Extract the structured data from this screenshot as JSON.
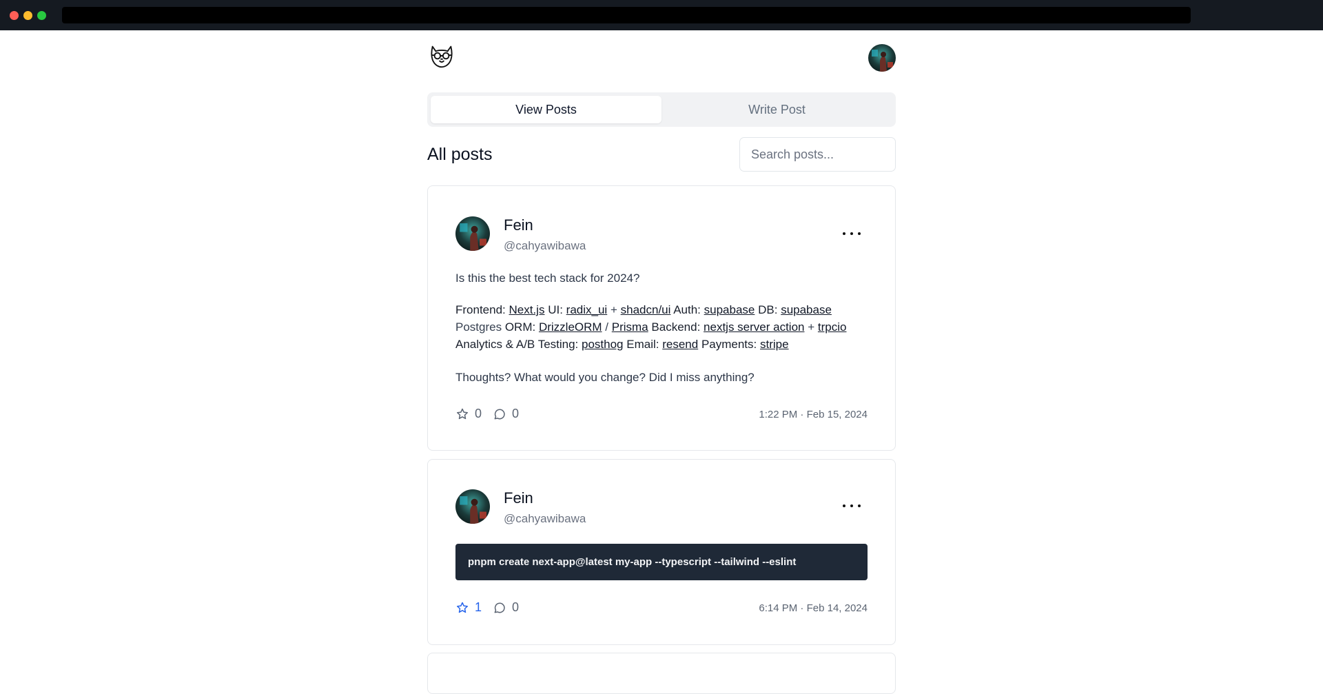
{
  "header": {
    "logo_icon": "cat-glasses-icon",
    "profile_icon": "avatar"
  },
  "tabs": [
    {
      "label": "View Posts",
      "active": true
    },
    {
      "label": "Write Post",
      "active": false
    }
  ],
  "main": {
    "heading": "All posts",
    "search_placeholder": "Search posts..."
  },
  "posts": [
    {
      "name": "Fein",
      "handle": "@cahyawibawa",
      "line1": "Is this the best tech stack for 2024?",
      "stack": {
        "frontend_label": "Frontend:",
        "frontend_link": "Next.js",
        "ui_label": "UI:",
        "ui_link1": "radix_ui",
        "plus1": "+",
        "ui_link2": "shadcn/ui",
        "auth_label": "Auth:",
        "auth_link": "supabase",
        "db_label": "DB:",
        "db_link": "supabase",
        "db_extra": "Postgres",
        "orm_label": "ORM:",
        "orm_link1": "DrizzleORM",
        "slash": "/",
        "orm_link2": "Prisma",
        "backend_label": "Backend:",
        "backend_link": "nextjs server action",
        "plus2": "+",
        "backend_link2": "trpcio",
        "analytics_label": "Analytics & A/B Testing:",
        "analytics_link": "posthog",
        "email_label": "Email:",
        "email_link": "resend",
        "payments_label": "Payments:",
        "payments_link": "stripe"
      },
      "line3": "Thoughts? What would you change? Did I miss anything?",
      "stars": "0",
      "comments": "0",
      "starred": false,
      "time": "1:22 PM · Feb 15, 2024"
    },
    {
      "name": "Fein",
      "handle": "@cahyawibawa",
      "code": "pnpm create next-app@latest my-app --typescript --tailwind --eslint",
      "stars": "1",
      "comments": "0",
      "starred": true,
      "time": "6:14 PM · Feb 14, 2024"
    }
  ],
  "colors": {
    "accent": "#2563eb",
    "code_bg": "#1f2937",
    "tab_bg": "#f1f2f4"
  }
}
